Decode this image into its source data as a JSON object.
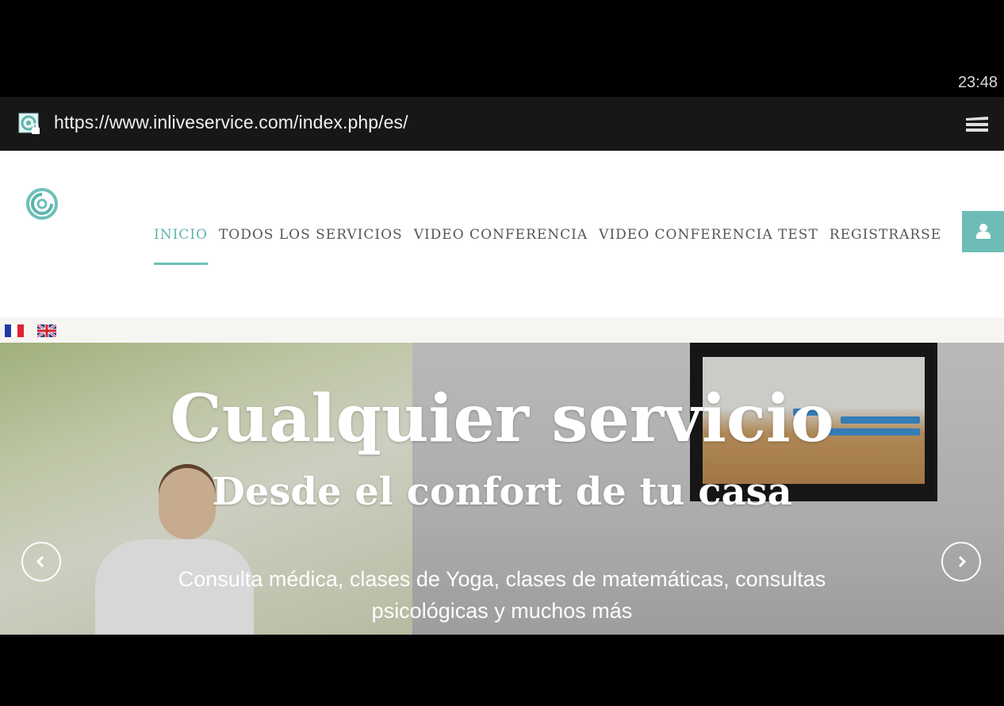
{
  "status_bar": {
    "time": "23:48"
  },
  "browser": {
    "url": "https://www.inliveservice.com/index.php/es/"
  },
  "nav": {
    "items": [
      {
        "label": "INICIO",
        "active": true
      },
      {
        "label": "TODOS LOS SERVICIOS",
        "active": false
      },
      {
        "label": "VIDEO CONFERENCIA",
        "active": false
      },
      {
        "label": "VIDEO CONFERENCIA TEST",
        "active": false
      },
      {
        "label": "REGISTRARSE",
        "active": false
      }
    ],
    "accent_color": "#6cc0b8"
  },
  "languages": [
    {
      "icon": "flag-france-icon"
    },
    {
      "icon": "flag-uk-icon"
    }
  ],
  "hero": {
    "title": "Cualquier servicio",
    "subtitle": "Desde el confort de tu casa",
    "description": "Consulta médica, clases de Yoga, clases de matemáticas, consultas psicológicas y muchos más",
    "prev_icon": "chevron-left-icon",
    "next_icon": "chevron-right-icon"
  }
}
